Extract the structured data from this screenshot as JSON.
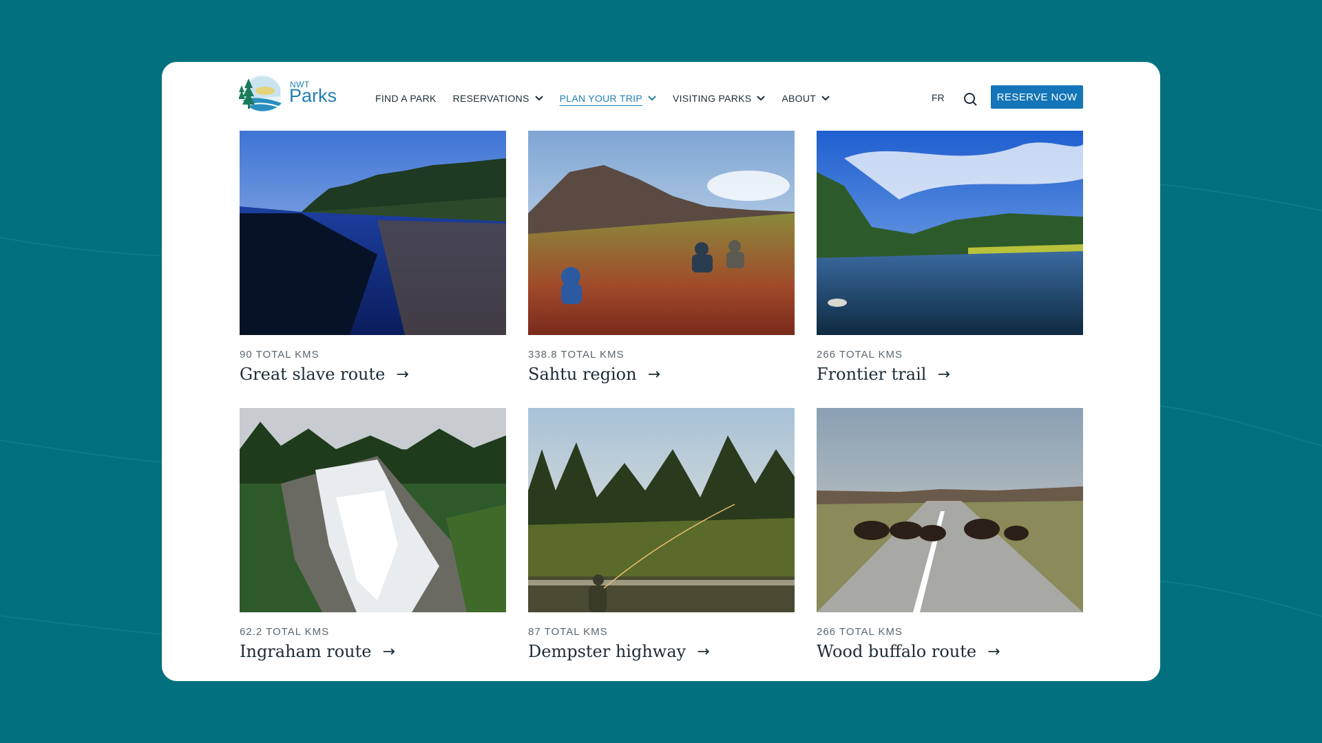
{
  "brand": {
    "small": "NWT",
    "name": "Parks"
  },
  "nav": [
    {
      "label": "FIND A PARK",
      "dropdown": false,
      "active": false
    },
    {
      "label": "RESERVATIONS",
      "dropdown": true,
      "active": false
    },
    {
      "label": "PLAN YOUR TRIP",
      "dropdown": true,
      "active": true
    },
    {
      "label": "VISITING PARKS",
      "dropdown": true,
      "active": false
    },
    {
      "label": "ABOUT",
      "dropdown": true,
      "active": false
    }
  ],
  "language": "FR",
  "reserve_label": "RESERVE NOW",
  "arrow": "→",
  "routes": [
    {
      "kms": "90 TOTAL KMS",
      "name": "Great slave route",
      "photo": "river-forest-photo"
    },
    {
      "kms": "338.8 TOTAL KMS",
      "name": "Sahtu region",
      "photo": "tundra-hikers-photo"
    },
    {
      "kms": "266 TOTAL KMS",
      "name": "Frontier trail",
      "photo": "lake-sky-photo"
    },
    {
      "kms": "62.2 TOTAL KMS",
      "name": "Ingraham route",
      "photo": "waterfall-photo"
    },
    {
      "kms": "87 TOTAL KMS",
      "name": "Dempster highway",
      "photo": "fly-fishing-photo"
    },
    {
      "kms": "266 TOTAL KMS",
      "name": "Wood buffalo route",
      "photo": "bison-road-photo"
    }
  ],
  "colors": {
    "background": "#02707f",
    "accent": "#1475b8",
    "text": "#1c2b36"
  }
}
